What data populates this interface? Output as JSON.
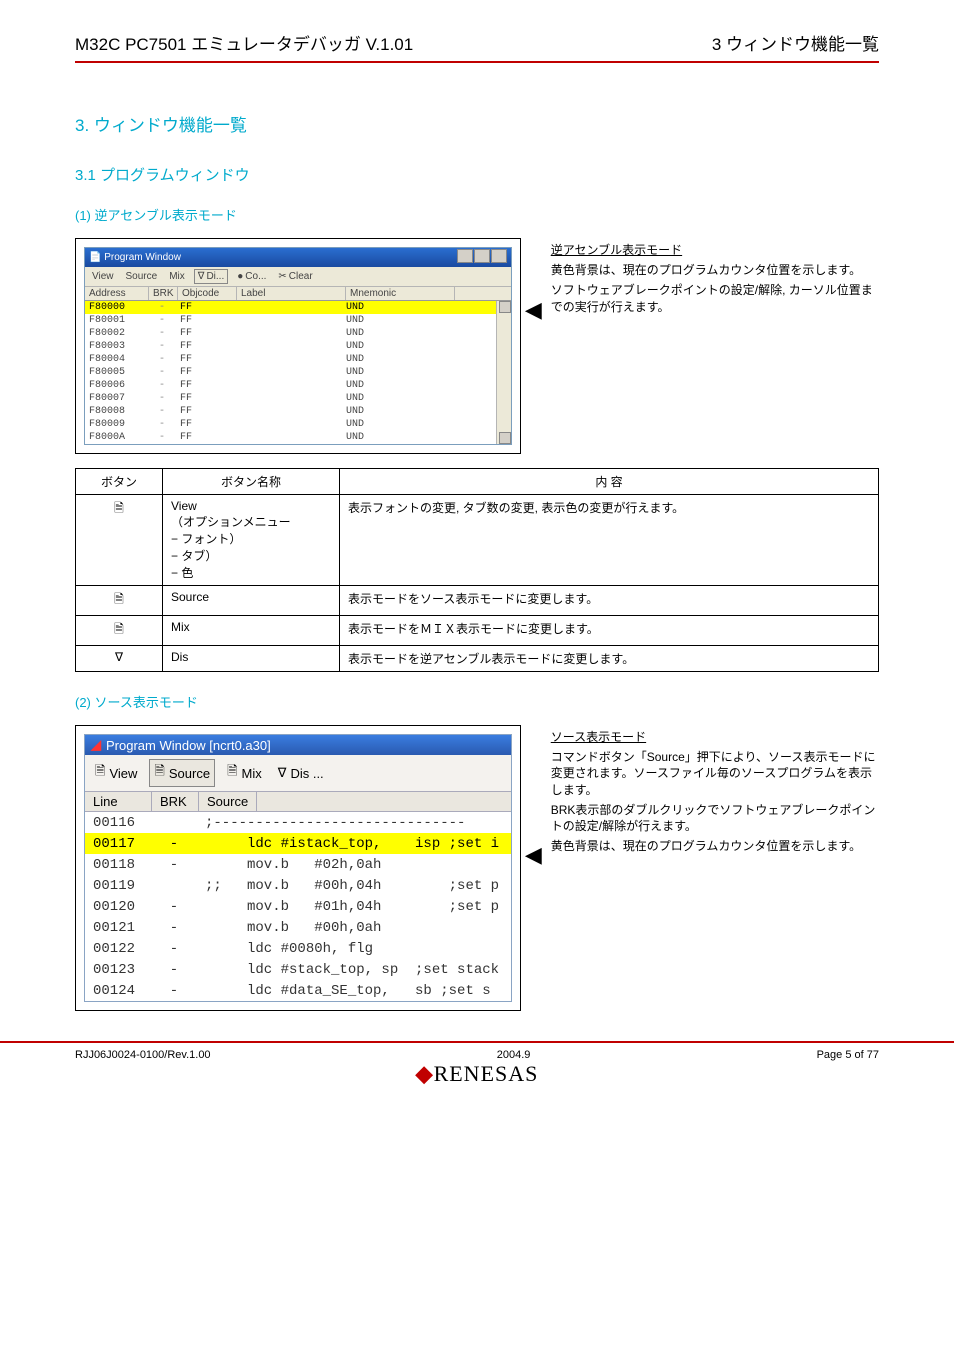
{
  "header": {
    "left": "M32C PC7501 エミュレータデバッガ V.1.01",
    "right": "3 ウィンドウ機能一覧"
  },
  "sec1": {
    "num": "3. ウィンドウ機能一覧",
    "sub": "3.1  プログラムウィンドウ"
  },
  "sub_disasm": "(1) 逆アセンブル表示モード",
  "fig1": {
    "colhead": {
      "addr": "Address",
      "brk": "BRK",
      "obj": "Objcode",
      "lab": "Label",
      "mne": "Mnemonic"
    },
    "toolbar": {
      "view": "View",
      "source": "Source",
      "mix": "Mix",
      "dis": "Di...",
      "co": "Co...",
      "clear": "Clear"
    },
    "rows": [
      {
        "addr": "F80000",
        "brk": "-",
        "obj": "FF",
        "mne": "UND",
        "hl": true
      },
      {
        "addr": "F80001",
        "brk": "-",
        "obj": "FF",
        "mne": "UND"
      },
      {
        "addr": "F80002",
        "brk": "-",
        "obj": "FF",
        "mne": "UND"
      },
      {
        "addr": "F80003",
        "brk": "-",
        "obj": "FF",
        "mne": "UND"
      },
      {
        "addr": "F80004",
        "brk": "-",
        "obj": "FF",
        "mne": "UND"
      },
      {
        "addr": "F80005",
        "brk": "-",
        "obj": "FF",
        "mne": "UND"
      },
      {
        "addr": "F80006",
        "brk": "-",
        "obj": "FF",
        "mne": "UND"
      },
      {
        "addr": "F80007",
        "brk": "-",
        "obj": "FF",
        "mne": "UND"
      },
      {
        "addr": "F80008",
        "brk": "-",
        "obj": "FF",
        "mne": "UND"
      },
      {
        "addr": "F80009",
        "brk": "-",
        "obj": "FF",
        "mne": "UND"
      },
      {
        "addr": "F8000A",
        "brk": "-",
        "obj": "FF",
        "mne": "UND"
      }
    ],
    "right_title": "逆アセンブル表示モード",
    "right_p1": "黄色背景は、現在のプログラムカウンタ位置を示します。",
    "right_p2": "ソフトウェアブレークポイントの設定/解除, カーソル位置までの実行が行えます。"
  },
  "table": {
    "h1": "ボタン",
    "h2": "ボタン名称",
    "h3": "内            容",
    "rows": [
      {
        "name": "View\n（オプションメニュー\n    − フォント）\n    − タブ）\n    − 色",
        "desc": "表示フォントの変更, タブ数の変更, 表示色の変更が行えます。"
      },
      {
        "name": "Source",
        "desc": "表示モードをソース表示モードに変更します。"
      },
      {
        "name": "Mix",
        "desc": "表示モードをＭＩＸ表示モードに変更します。"
      },
      {
        "name": "Dis",
        "desc": "表示モードを逆アセンブル表示モードに変更します。"
      }
    ]
  },
  "sub_source": "(2) ソース表示モード",
  "fig2": {
    "title": "Program Window [ncrt0.a30]",
    "toolbar": {
      "view": "View",
      "source": "Source",
      "mix": "Mix",
      "dis": "Dis ..."
    },
    "cols": {
      "line": "Line",
      "brk": "BRK",
      "src": "Source"
    },
    "rows": [
      {
        "line": "00116",
        "brk": "",
        "src": ";------------------------------"
      },
      {
        "line": "00117",
        "brk": "-",
        "src": "     ldc #istack_top,    isp ;set i",
        "hl": true
      },
      {
        "line": "00118",
        "brk": "-",
        "src": "     mov.b   #02h,0ah"
      },
      {
        "line": "00119",
        "brk": "",
        "src": ";;   mov.b   #00h,04h        ;set p"
      },
      {
        "line": "00120",
        "brk": "-",
        "src": "     mov.b   #01h,04h        ;set p"
      },
      {
        "line": "00121",
        "brk": "-",
        "src": "     mov.b   #00h,0ah"
      },
      {
        "line": "00122",
        "brk": "-",
        "src": "     ldc #0080h, flg"
      },
      {
        "line": "00123",
        "brk": "-",
        "src": "     ldc #stack_top, sp  ;set stack"
      },
      {
        "line": "00124",
        "brk": "-",
        "src": "     ldc #data_SE_top,   sb ;set s"
      }
    ],
    "right_title": "ソース表示モード",
    "right_p1": "コマンドボタン「Source」押下により、ソース表示モードに変更されます。ソースファイル毎のソースプログラムを表示します。",
    "right_p2": "BRK表示部のダブルクリックでソフトウェアブレークポイントの設定/解除が行えます。",
    "right_p3": "黄色背景は、現在のプログラムカウンタ位置を示します。"
  },
  "footer": {
    "left": "RJJ06J0024-0100/Rev.1.00",
    "center": "2004.9",
    "page": "Page 5 of 77"
  },
  "win_title": "Program Window"
}
